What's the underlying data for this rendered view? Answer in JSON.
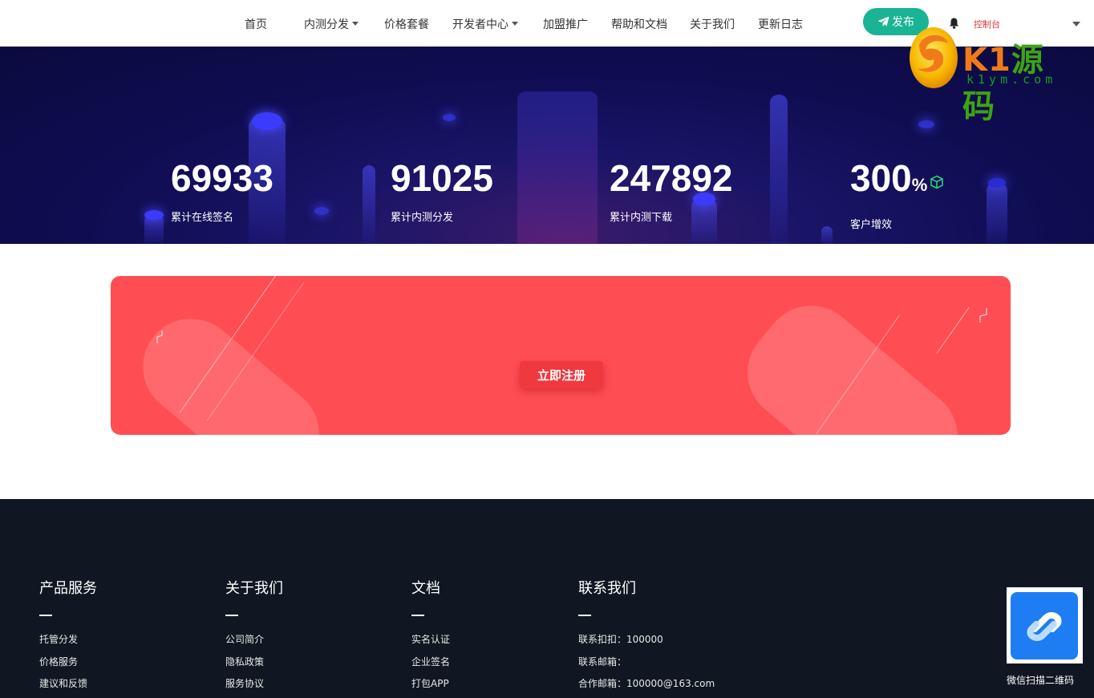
{
  "nav": {
    "items": [
      {
        "label": "首页",
        "dropdown": false
      },
      {
        "label": "内测分发",
        "dropdown": true
      },
      {
        "label": "价格套餐",
        "dropdown": false
      },
      {
        "label": "开发者中心",
        "dropdown": true
      },
      {
        "label": "加盟推广",
        "dropdown": false
      },
      {
        "label": "帮助和文档",
        "dropdown": false
      },
      {
        "label": "关于我们",
        "dropdown": false
      },
      {
        "label": "更新日志",
        "dropdown": false
      }
    ],
    "publish_label": "发布",
    "console_label": "控制台",
    "icons": {
      "publish": "paper-plane-icon",
      "bell": "bell-icon",
      "user_menu": "chevron-down-icon"
    }
  },
  "watermark": {
    "main_a": "K1",
    "main_b": "源码",
    "sub": "k1ym.com"
  },
  "stats": [
    {
      "value": "69933",
      "unit": "",
      "label": "累计在线签名"
    },
    {
      "value": "91025",
      "unit": "",
      "label": "累计内测分发"
    },
    {
      "value": "247892",
      "unit": "",
      "label": "累计内测下载"
    },
    {
      "value": "300",
      "unit": "%",
      "label": "客户增效"
    }
  ],
  "register": {
    "button_label": "立即注册"
  },
  "footer": {
    "products": {
      "title": "产品服务",
      "links": [
        "托管分发",
        "价格服务",
        "建议和反馈"
      ]
    },
    "about": {
      "title": "关于我们",
      "links": [
        "公司简介",
        "隐私政策",
        "服务协议"
      ]
    },
    "docs": {
      "title": "文档",
      "links": [
        "实名认证",
        "企业签名",
        "打包APP"
      ]
    },
    "contact": {
      "title": "联系我们",
      "lines": [
        "联系扣扣：100000",
        "联系邮箱：",
        "合作邮箱：100000@163.com"
      ]
    },
    "qr_caption": "微信扫描二维码"
  },
  "colors": {
    "accent_green": "#1ab394",
    "console_red": "#e2333a",
    "card_red": "#ff4d54",
    "footer_bg": "#101722"
  }
}
